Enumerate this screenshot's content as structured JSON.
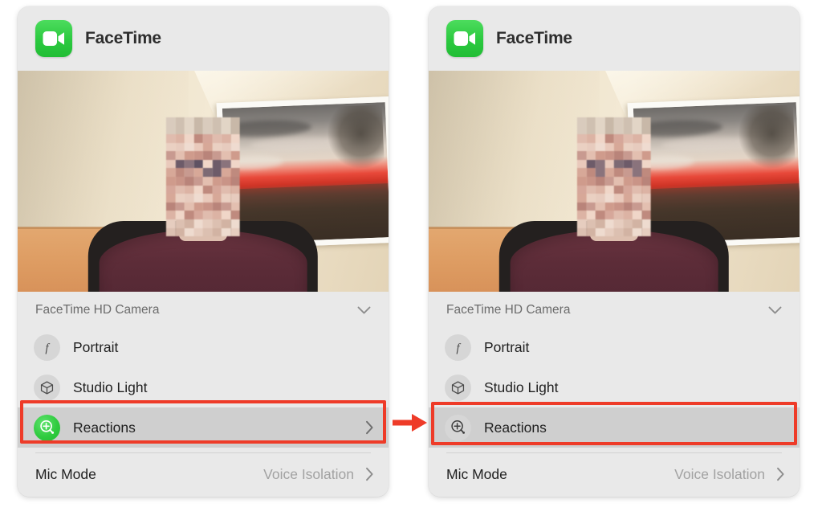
{
  "panels": [
    {
      "id": "before",
      "app_title": "FaceTime",
      "app_icon": "facetime-video-icon",
      "device": {
        "label": "FaceTime HD Camera",
        "chevron": "chevron-down-icon"
      },
      "options": [
        {
          "label": "Portrait",
          "icon": "aperture-f-icon",
          "active": false,
          "highlighted": false,
          "chevron": ""
        },
        {
          "label": "Studio Light",
          "icon": "cube-icon",
          "active": false,
          "highlighted": false,
          "chevron": ""
        },
        {
          "label": "Reactions",
          "icon": "reactions-plus-icon",
          "active": true,
          "highlighted": true,
          "chevron": "chevron-right-icon"
        }
      ],
      "mic": {
        "label": "Mic Mode",
        "value": "Voice Isolation",
        "chevron": "chevron-right-icon"
      }
    },
    {
      "id": "after",
      "app_title": "FaceTime",
      "app_icon": "facetime-video-icon",
      "device": {
        "label": "FaceTime HD Camera",
        "chevron": "chevron-down-icon"
      },
      "options": [
        {
          "label": "Portrait",
          "icon": "aperture-f-icon",
          "active": false,
          "highlighted": false,
          "chevron": ""
        },
        {
          "label": "Studio Light",
          "icon": "cube-icon",
          "active": false,
          "highlighted": false,
          "chevron": ""
        },
        {
          "label": "Reactions",
          "icon": "reactions-plus-icon",
          "active": false,
          "highlighted": true,
          "chevron": ""
        }
      ],
      "mic": {
        "label": "Mic Mode",
        "value": "Voice Isolation",
        "chevron": "chevron-right-icon"
      }
    }
  ],
  "annotations": {
    "highlight_color": "#ee3b28",
    "arrow": "red-right-arrow",
    "highlighted_row_label": "Reactions"
  },
  "colors": {
    "accent_green": "#2fcb3f",
    "annotation_red": "#ee3b28",
    "panel_background": "#e9e9e9",
    "row_highlight": "#cfcfcf",
    "primary_text": "#1f1f1f",
    "secondary_text": "#a2a2a2"
  }
}
